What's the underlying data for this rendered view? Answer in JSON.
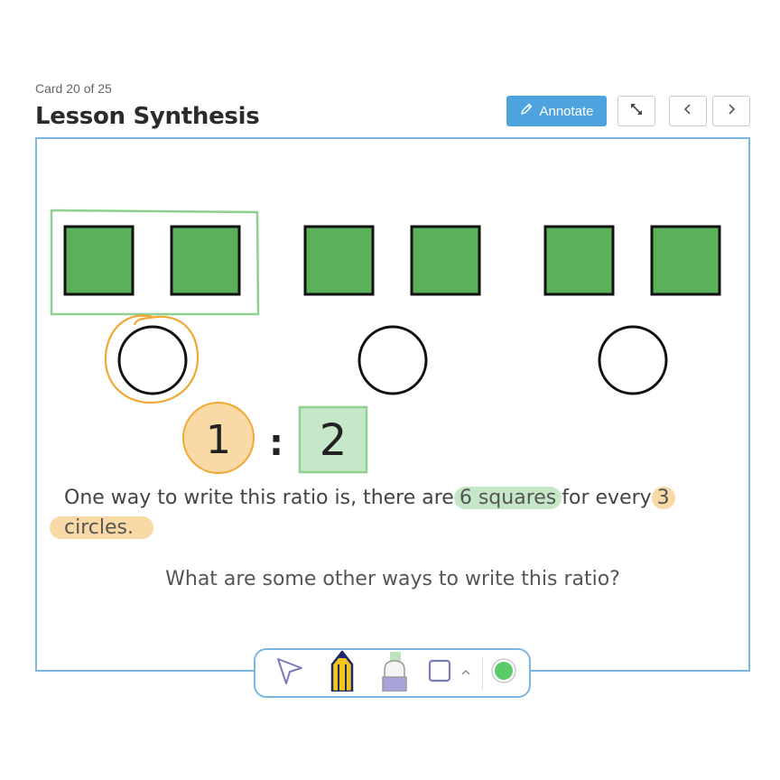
{
  "header": {
    "card_count": "Card 20 of 25",
    "title": "Lesson Synthesis",
    "annotate_label": "Annotate"
  },
  "slide": {
    "ratio_left": "1",
    "ratio_sep": ":",
    "ratio_right": "2",
    "sentence_part1": "One way to write this ratio is, there are",
    "highlight_squares": "6 squares",
    "sentence_part2": "for every",
    "highlight_circles_a": "3",
    "highlight_circles_b": "circles.",
    "question": "What are some other ways to write this ratio?"
  },
  "colors": {
    "accent": "#4ea3de",
    "square_fill": "#5bb05a",
    "green_highlight": "#c7e7c9",
    "orange_highlight": "#f9d9a6",
    "orange_ink": "#f0a830",
    "slide_border": "#7cb7e0"
  },
  "toolbar": {
    "tools": [
      "select-arrow-icon",
      "pencil-icon",
      "highlighter-icon",
      "shape-square-icon",
      "chevron-up-icon",
      "color-swatch-icon"
    ]
  }
}
